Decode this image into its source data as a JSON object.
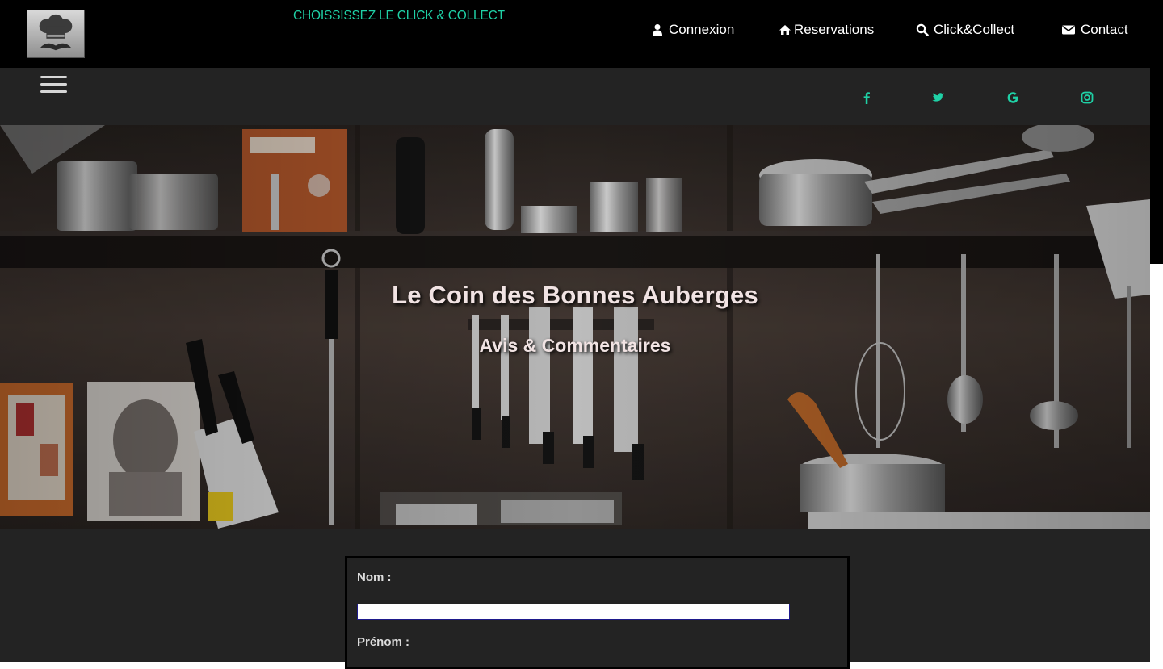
{
  "header": {
    "promo": "CHOISSISSEZ LE CLICK & COLLECT",
    "nav": [
      {
        "label": "Connexion",
        "icon": "user-icon"
      },
      {
        "label": "Reservations",
        "icon": "home-icon"
      },
      {
        "label": "Click&Collect",
        "icon": "search-icon"
      },
      {
        "label": "Contact",
        "icon": "envelope-icon"
      }
    ],
    "logo_icon": "chef-hat-mustache-logo"
  },
  "subbar": {
    "menu_icon": "hamburger-menu-icon",
    "social": [
      "facebook-icon",
      "twitter-icon",
      "google-icon",
      "instagram-icon"
    ]
  },
  "hero": {
    "title": "Le Coin des Bonnes Auberges",
    "subtitle": "Avis & Commentaires"
  },
  "form": {
    "nom_label": "Nom :",
    "nom_value": "",
    "prenom_label": "Prénom :"
  },
  "colors": {
    "accent": "#1fd1a6",
    "topbar": "#000000",
    "panel": "#232323",
    "hero_text": "#f1e3e3"
  }
}
